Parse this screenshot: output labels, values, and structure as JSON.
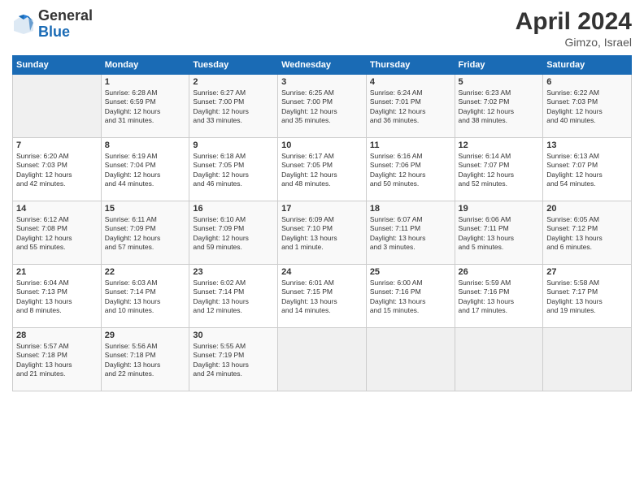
{
  "header": {
    "logo_general": "General",
    "logo_blue": "Blue",
    "month_title": "April 2024",
    "location": "Gimzo, Israel"
  },
  "days_of_week": [
    "Sunday",
    "Monday",
    "Tuesday",
    "Wednesday",
    "Thursday",
    "Friday",
    "Saturday"
  ],
  "weeks": [
    [
      {
        "day": "",
        "info": ""
      },
      {
        "day": "1",
        "info": "Sunrise: 6:28 AM\nSunset: 6:59 PM\nDaylight: 12 hours\nand 31 minutes."
      },
      {
        "day": "2",
        "info": "Sunrise: 6:27 AM\nSunset: 7:00 PM\nDaylight: 12 hours\nand 33 minutes."
      },
      {
        "day": "3",
        "info": "Sunrise: 6:25 AM\nSunset: 7:00 PM\nDaylight: 12 hours\nand 35 minutes."
      },
      {
        "day": "4",
        "info": "Sunrise: 6:24 AM\nSunset: 7:01 PM\nDaylight: 12 hours\nand 36 minutes."
      },
      {
        "day": "5",
        "info": "Sunrise: 6:23 AM\nSunset: 7:02 PM\nDaylight: 12 hours\nand 38 minutes."
      },
      {
        "day": "6",
        "info": "Sunrise: 6:22 AM\nSunset: 7:03 PM\nDaylight: 12 hours\nand 40 minutes."
      }
    ],
    [
      {
        "day": "7",
        "info": "Sunrise: 6:20 AM\nSunset: 7:03 PM\nDaylight: 12 hours\nand 42 minutes."
      },
      {
        "day": "8",
        "info": "Sunrise: 6:19 AM\nSunset: 7:04 PM\nDaylight: 12 hours\nand 44 minutes."
      },
      {
        "day": "9",
        "info": "Sunrise: 6:18 AM\nSunset: 7:05 PM\nDaylight: 12 hours\nand 46 minutes."
      },
      {
        "day": "10",
        "info": "Sunrise: 6:17 AM\nSunset: 7:05 PM\nDaylight: 12 hours\nand 48 minutes."
      },
      {
        "day": "11",
        "info": "Sunrise: 6:16 AM\nSunset: 7:06 PM\nDaylight: 12 hours\nand 50 minutes."
      },
      {
        "day": "12",
        "info": "Sunrise: 6:14 AM\nSunset: 7:07 PM\nDaylight: 12 hours\nand 52 minutes."
      },
      {
        "day": "13",
        "info": "Sunrise: 6:13 AM\nSunset: 7:07 PM\nDaylight: 12 hours\nand 54 minutes."
      }
    ],
    [
      {
        "day": "14",
        "info": "Sunrise: 6:12 AM\nSunset: 7:08 PM\nDaylight: 12 hours\nand 55 minutes."
      },
      {
        "day": "15",
        "info": "Sunrise: 6:11 AM\nSunset: 7:09 PM\nDaylight: 12 hours\nand 57 minutes."
      },
      {
        "day": "16",
        "info": "Sunrise: 6:10 AM\nSunset: 7:09 PM\nDaylight: 12 hours\nand 59 minutes."
      },
      {
        "day": "17",
        "info": "Sunrise: 6:09 AM\nSunset: 7:10 PM\nDaylight: 13 hours\nand 1 minute."
      },
      {
        "day": "18",
        "info": "Sunrise: 6:07 AM\nSunset: 7:11 PM\nDaylight: 13 hours\nand 3 minutes."
      },
      {
        "day": "19",
        "info": "Sunrise: 6:06 AM\nSunset: 7:11 PM\nDaylight: 13 hours\nand 5 minutes."
      },
      {
        "day": "20",
        "info": "Sunrise: 6:05 AM\nSunset: 7:12 PM\nDaylight: 13 hours\nand 6 minutes."
      }
    ],
    [
      {
        "day": "21",
        "info": "Sunrise: 6:04 AM\nSunset: 7:13 PM\nDaylight: 13 hours\nand 8 minutes."
      },
      {
        "day": "22",
        "info": "Sunrise: 6:03 AM\nSunset: 7:14 PM\nDaylight: 13 hours\nand 10 minutes."
      },
      {
        "day": "23",
        "info": "Sunrise: 6:02 AM\nSunset: 7:14 PM\nDaylight: 13 hours\nand 12 minutes."
      },
      {
        "day": "24",
        "info": "Sunrise: 6:01 AM\nSunset: 7:15 PM\nDaylight: 13 hours\nand 14 minutes."
      },
      {
        "day": "25",
        "info": "Sunrise: 6:00 AM\nSunset: 7:16 PM\nDaylight: 13 hours\nand 15 minutes."
      },
      {
        "day": "26",
        "info": "Sunrise: 5:59 AM\nSunset: 7:16 PM\nDaylight: 13 hours\nand 17 minutes."
      },
      {
        "day": "27",
        "info": "Sunrise: 5:58 AM\nSunset: 7:17 PM\nDaylight: 13 hours\nand 19 minutes."
      }
    ],
    [
      {
        "day": "28",
        "info": "Sunrise: 5:57 AM\nSunset: 7:18 PM\nDaylight: 13 hours\nand 21 minutes."
      },
      {
        "day": "29",
        "info": "Sunrise: 5:56 AM\nSunset: 7:18 PM\nDaylight: 13 hours\nand 22 minutes."
      },
      {
        "day": "30",
        "info": "Sunrise: 5:55 AM\nSunset: 7:19 PM\nDaylight: 13 hours\nand 24 minutes."
      },
      {
        "day": "",
        "info": ""
      },
      {
        "day": "",
        "info": ""
      },
      {
        "day": "",
        "info": ""
      },
      {
        "day": "",
        "info": ""
      }
    ]
  ]
}
